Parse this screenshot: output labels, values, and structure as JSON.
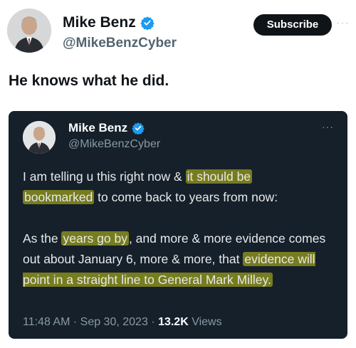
{
  "outer": {
    "name": "Mike Benz",
    "handle": "@MikeBenzCyber",
    "subscribe_label": "Subscribe",
    "more_label": "···",
    "text": "He knows what he did."
  },
  "quoted": {
    "name": "Mike Benz",
    "handle": "@MikeBenzCyber",
    "more_label": "···",
    "p1_a": "I am telling u this right now & ",
    "p1_hl1": "it should be",
    "p1_hl2": "bookmarked",
    "p1_b": " to come back to years from now:",
    "p2_a": "As the ",
    "p2_hl1": "years go by",
    "p2_b": ", and more & more evidence comes out about January 6, more & more, that ",
    "p2_hl2": "evidence will point in a straight line to General Mark Milley.",
    "time": "11:48 AM",
    "date": "Sep 30, 2023",
    "views_count": "13.2K",
    "views_label": "Views",
    "sep": " · "
  },
  "colors": {
    "verified": "#1d9bf0",
    "highlight": "#c8c814",
    "card_bg": "#15202b"
  },
  "icons": [
    "verified-badge-icon",
    "more-options-icon"
  ]
}
